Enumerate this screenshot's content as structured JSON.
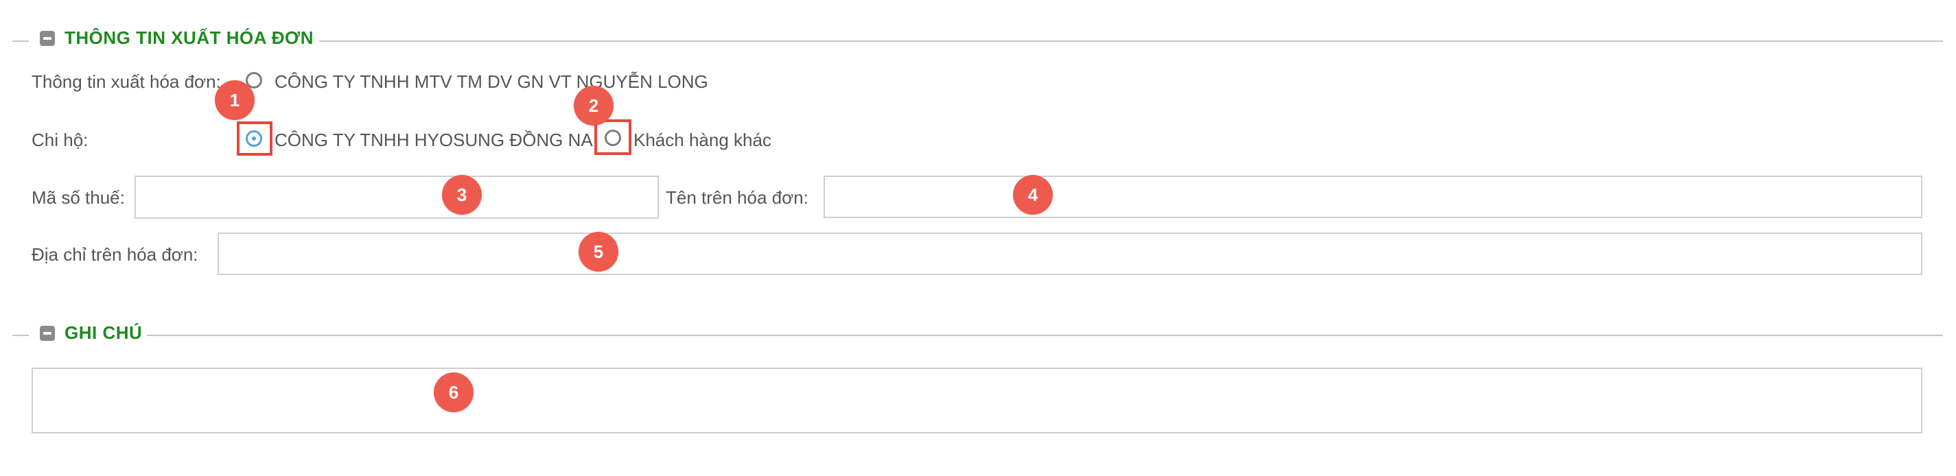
{
  "invoice_section": {
    "title": "THÔNG TIN XUẤT HÓA ĐƠN",
    "invoice_info_label": "Thông tin xuất hóa đơn:",
    "invoice_info_option": "CÔNG TY TNHH MTV TM DV GN VT NGUYỄN LONG",
    "pay_on_behalf_label": "Chi hộ:",
    "pay_on_behalf_options": [
      {
        "label": "CÔNG TY TNHH HYOSUNG ĐỒNG NA",
        "checked": true
      },
      {
        "label": "Khách hàng khác",
        "checked": false
      }
    ],
    "tax_code_label": "Mã số thuế:",
    "tax_code_value": "",
    "invoice_name_label": "Tên trên hóa đơn:",
    "invoice_name_value": "",
    "invoice_address_label": "Địa chỉ trên hóa đơn:",
    "invoice_address_value": ""
  },
  "notes_section": {
    "title": "GHI CHÚ",
    "notes_value": ""
  },
  "markers": [
    "1",
    "2",
    "3",
    "4",
    "5",
    "6"
  ],
  "colors": {
    "section_title": "#1f8a1f",
    "marker": "#ef5a4f",
    "highlight": "#e5473f",
    "radio_checked": "#4fa3d8"
  }
}
